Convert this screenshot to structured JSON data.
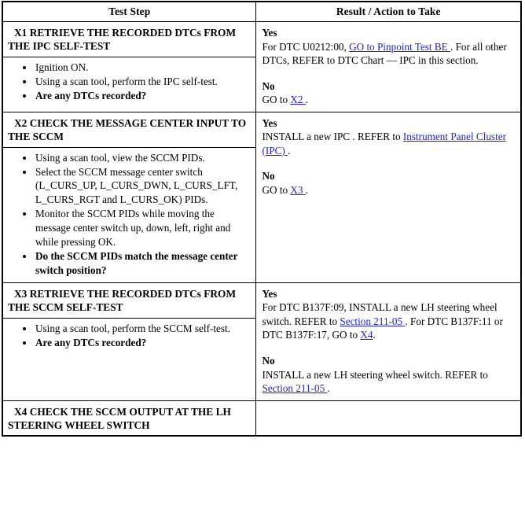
{
  "table": {
    "columns": [
      {
        "label": "Test Step"
      },
      {
        "label": "Result / Action to Take"
      }
    ],
    "steps": [
      {
        "id": "X1",
        "title": "X1 RETRIEVE THE RECORDED DTCs FROM THE IPC SELF-TEST",
        "items": [
          {
            "text": "Ignition ON.",
            "bold": false
          },
          {
            "text": "Using a scan tool, perform the IPC self-test.",
            "bold": false
          },
          {
            "text": "Are any DTCs recorded?",
            "bold": true
          }
        ],
        "results": [
          {
            "label": "Yes",
            "parts": [
              {
                "type": "text",
                "text": "For DTC U0212:00, "
              },
              {
                "type": "link",
                "text": "GO to Pinpoint Test BE "
              },
              {
                "type": "text",
                "text": ". For all other DTCs, REFER to DTC Chart — IPC in this section."
              }
            ]
          },
          {
            "label": "No",
            "parts": [
              {
                "type": "text",
                "text": "GO to "
              },
              {
                "type": "link",
                "text": "X2 "
              },
              {
                "type": "text",
                "text": "."
              }
            ]
          }
        ]
      },
      {
        "id": "X2",
        "title": "X2 CHECK THE MESSAGE CENTER INPUT TO THE SCCM",
        "items": [
          {
            "text": "Using a scan tool, view the SCCM PIDs.",
            "bold": false
          },
          {
            "text": "Select the SCCM message center switch (L_CURS_UP, L_CURS_DWN, L_CURS_LFT, L_CURS_RGT and L_CURS_OK) PIDs.",
            "bold": false
          },
          {
            "text": "Monitor the SCCM PIDs while moving the message center switch up, down, left, right and while pressing OK.",
            "bold": false
          },
          {
            "text": "Do the SCCM PIDs match the message center switch position?",
            "bold": true
          }
        ],
        "results": [
          {
            "label": "Yes",
            "parts": [
              {
                "type": "text",
                "text": "INSTALL a new IPC . REFER to "
              },
              {
                "type": "link",
                "text": "Instrument Panel Cluster (IPC) "
              },
              {
                "type": "text",
                "text": "."
              }
            ]
          },
          {
            "label": "No",
            "parts": [
              {
                "type": "text",
                "text": "GO to "
              },
              {
                "type": "link",
                "text": "X3 "
              },
              {
                "type": "text",
                "text": "."
              }
            ]
          }
        ]
      },
      {
        "id": "X3",
        "title": "X3 RETRIEVE THE RECORDED DTCs FROM THE SCCM SELF-TEST",
        "items": [
          {
            "text": "Using a scan tool, perform the SCCM self-test.",
            "bold": false
          },
          {
            "text": "Are any DTCs recorded?",
            "bold": true
          }
        ],
        "results": [
          {
            "label": "Yes",
            "parts": [
              {
                "type": "text",
                "text": "For DTC B137F:09, INSTALL a new LH steering wheel switch. REFER to "
              },
              {
                "type": "link",
                "text": "Section 211-05 "
              },
              {
                "type": "text",
                "text": ". For DTC B137F:11 or DTC B137F:17, GO to "
              },
              {
                "type": "link",
                "text": "X4"
              },
              {
                "type": "text",
                "text": "."
              }
            ]
          },
          {
            "label": "No",
            "parts": [
              {
                "type": "text",
                "text": "INSTALL a new LH steering wheel switch. REFER to "
              },
              {
                "type": "link",
                "text": "Section 211-05 "
              },
              {
                "type": "text",
                "text": "."
              }
            ]
          }
        ]
      },
      {
        "id": "X4",
        "title": "X4 CHECK THE SCCM OUTPUT AT THE LH STEERING WHEEL SWITCH",
        "items": [],
        "results": []
      }
    ]
  },
  "colors": {
    "link": "#2222cc",
    "border": "#000000",
    "text": "#000000"
  }
}
